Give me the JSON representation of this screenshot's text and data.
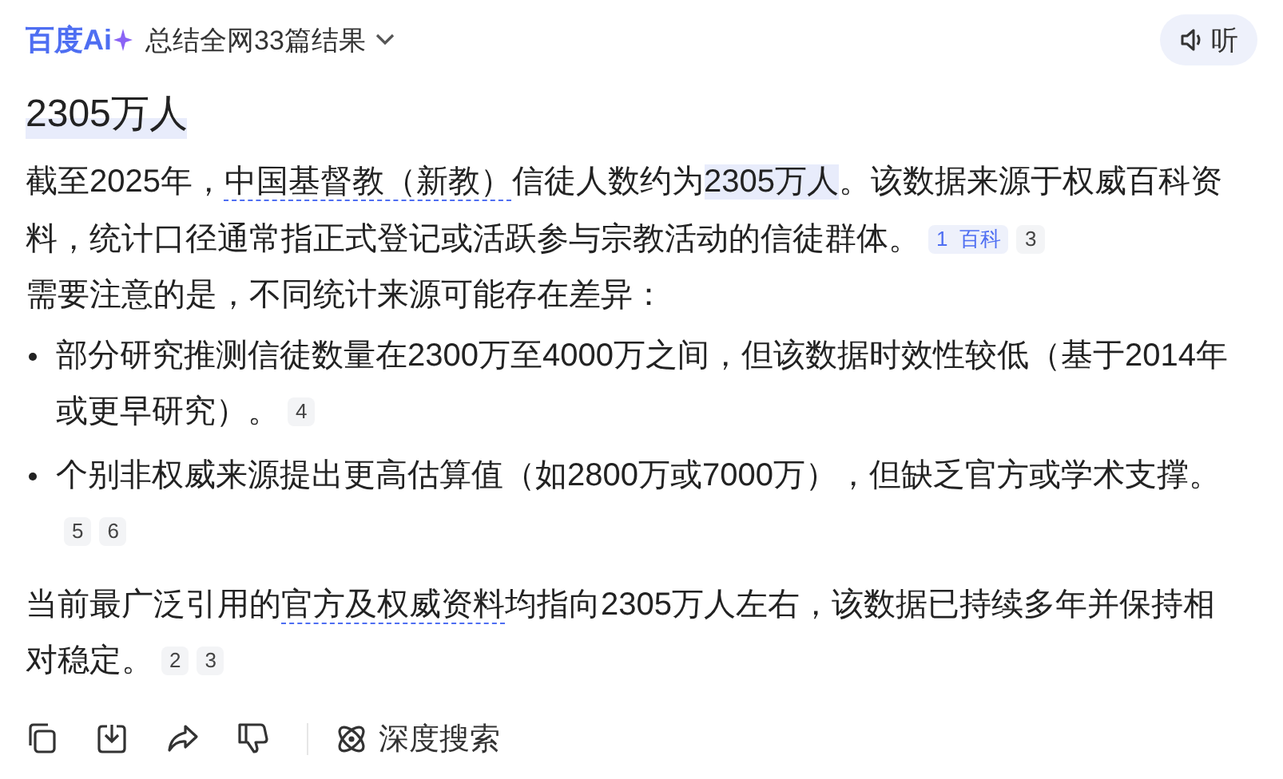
{
  "header": {
    "logo": "百度Ai",
    "summary": "总结全网33篇结果",
    "listen_button": "听"
  },
  "title": "2305万人",
  "blocks": [
    {
      "kind": "paragraph",
      "segments": [
        {
          "kind": "text",
          "text": "截至2025年，"
        },
        {
          "kind": "link",
          "text": "中国基督教（新教）"
        },
        {
          "kind": "text",
          "text": "信徒人数约为"
        },
        {
          "kind": "highlight",
          "text": "2305万人"
        },
        {
          "kind": "text",
          "text": "。该数据来源于权威百科资料，统计口径通常指正式登记或活跃参与宗教活动的信徒群体。"
        }
      ],
      "citations": [
        {
          "label": "1",
          "source": "百科"
        },
        {
          "label": "3"
        }
      ]
    },
    {
      "kind": "paragraph",
      "segments": [
        {
          "kind": "text",
          "text": "需要注意的是，不同统计来源可能存在差异："
        }
      ]
    },
    {
      "kind": "bullet",
      "segments": [
        {
          "kind": "text",
          "text": "部分研究推测信徒数量在2300万至4000万之间，但该数据时效性较低（基于2014年或更早研究）。"
        }
      ],
      "citations": [
        {
          "label": "4"
        }
      ]
    },
    {
      "kind": "bullet",
      "segments": [
        {
          "kind": "text",
          "text": "个别非权威来源提出更高估算值（如2800万或7000万），但缺乏官方或学术支撑。"
        }
      ],
      "citations": [
        {
          "label": "5"
        },
        {
          "label": "6"
        }
      ]
    },
    {
      "kind": "paragraph",
      "segments": [
        {
          "kind": "text",
          "text": "当前最广泛引用的"
        },
        {
          "kind": "link",
          "text": "官方及权威资料"
        },
        {
          "kind": "text",
          "text": "均指向2305万人左右，该数据已持续多年并保持相对稳定。"
        }
      ],
      "citations": [
        {
          "label": "2"
        },
        {
          "label": "3"
        }
      ]
    }
  ],
  "actions": [
    {
      "kind": "copy"
    },
    {
      "kind": "download"
    },
    {
      "kind": "share"
    },
    {
      "kind": "dislike"
    }
  ],
  "deep_search_button": "深度搜索"
}
